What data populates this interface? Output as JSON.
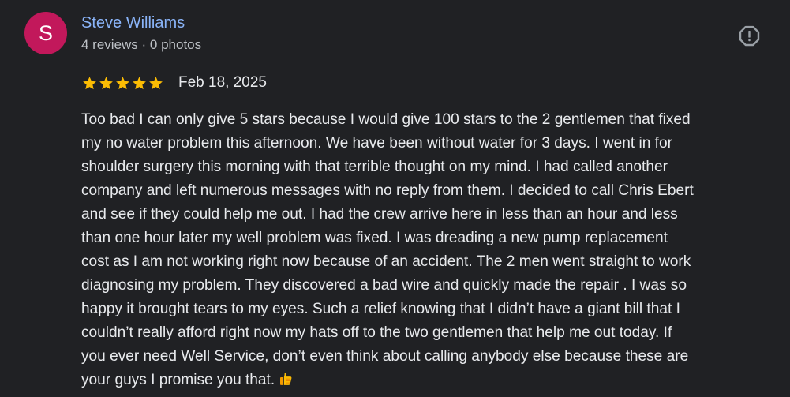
{
  "reviewer": {
    "initial": "S",
    "name": "Steve Williams",
    "meta": "4 reviews · 0 photos",
    "avatar_color": "#c2185b"
  },
  "rating": {
    "stars": 5,
    "max": 5,
    "star_color": "#fbbc04",
    "date": "Feb 18, 2025"
  },
  "review": {
    "lines": [
      "Too bad I can only give 5 stars because I would give 100 stars to the 2 gentlemen that fixed",
      "my no water problem this afternoon. We have been without water for 3 days. I went in for",
      "shoulder surgery this morning with that terrible thought on my mind. I had called another",
      "company and left numerous messages with no reply from them. I decided to call Chris Ebert",
      "and see if they could help me out. I had the crew arrive here in less than an hour and less",
      "than one hour later my well problem was fixed. I was dreading a new pump replacement",
      "cost as I am not working right now because of an accident. The 2 men went straight to work",
      "diagnosing my problem. They discovered a bad wire and quickly made the repair . I was so",
      "happy it brought tears to my eyes. Such a relief knowing that I didn’t have a giant bill that I",
      "couldn’t really afford right now my hats off to the two gentlemen that help me out today. If",
      "you ever need Well Service, don’t even think about calling anybody else because these are",
      "your guys I promise you that."
    ],
    "trailing_emoji": "thumbs-up-icon"
  },
  "icons": {
    "report": "report-flag-icon",
    "star": "star-icon"
  },
  "colors": {
    "background": "#202124",
    "name_link": "#8ab4f8",
    "text": "#e8eaed",
    "muted": "#bdc1c6"
  }
}
